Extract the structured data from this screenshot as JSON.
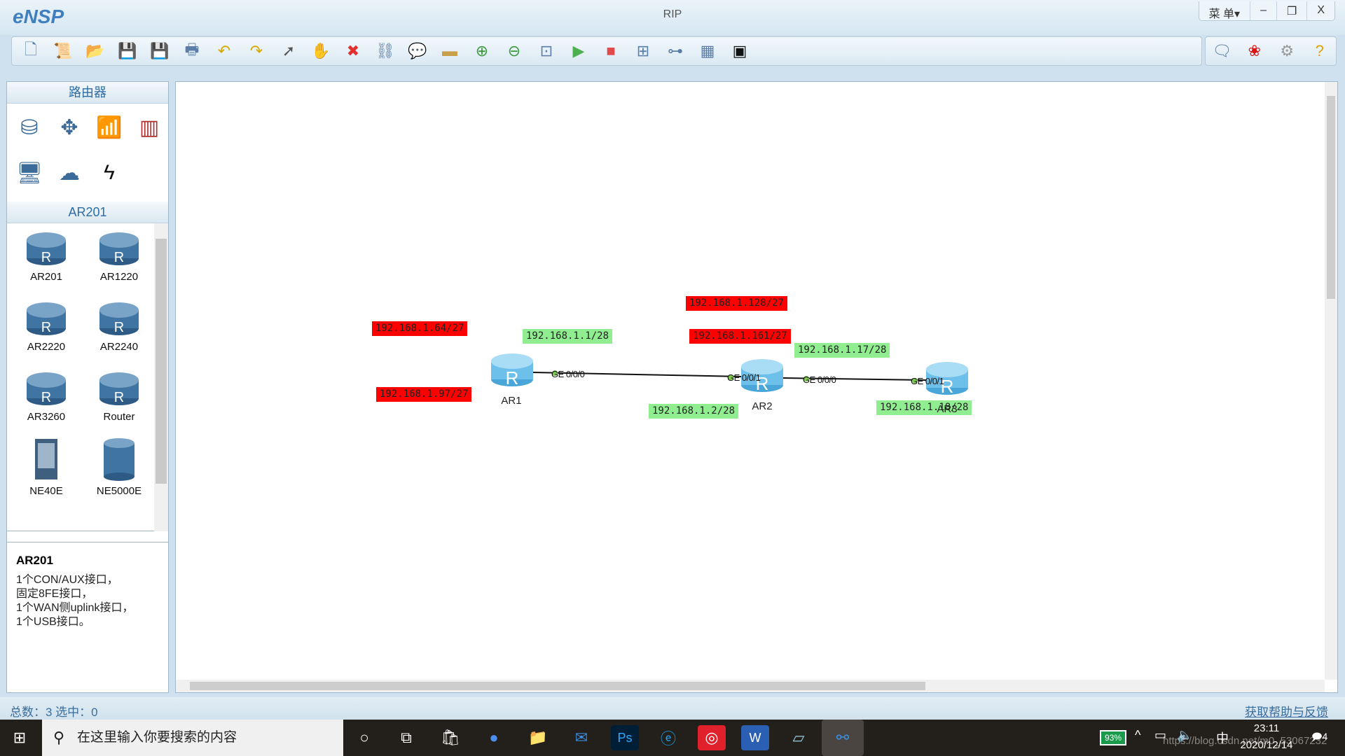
{
  "app": {
    "logo": "eNSP",
    "title": "RIP",
    "menu": "菜 单▾",
    "minimize": "–",
    "restore": "❐",
    "close": "X"
  },
  "toolbar": {
    "icons": [
      "new-topology-icon",
      "new-example-icon",
      "open-icon",
      "save-icon",
      "save-as-icon",
      "print-icon",
      "undo-icon",
      "redo-icon",
      "select-icon",
      "pan-hand-icon",
      "delete-icon",
      "delete-link-icon",
      "text-annotation-icon",
      "rectangle-icon",
      "zoom-in-icon",
      "zoom-out-icon",
      "fit-icon",
      "start-icon",
      "stop-icon",
      "capture-icon",
      "topology-icon",
      "grid-icon",
      "cli-icon"
    ],
    "right_icons": [
      "chat-icon",
      "huawei-icon",
      "settings-icon",
      "help-icon"
    ]
  },
  "sidebar": {
    "category_title": "路由器",
    "categories": [
      "router-icon",
      "switch-icon",
      "wireless-icon",
      "firewall-icon",
      "pc-icon",
      "cloud-icon",
      "link-icon"
    ],
    "device_title": "AR201",
    "devices": [
      {
        "label": "AR201"
      },
      {
        "label": "AR1220"
      },
      {
        "label": "AR2220"
      },
      {
        "label": "AR2240"
      },
      {
        "label": "AR3260"
      },
      {
        "label": "Router"
      },
      {
        "label": "NE40E"
      },
      {
        "label": "NE5000E"
      }
    ],
    "info": {
      "title": "AR201",
      "lines": [
        "1个CON/AUX接口，",
        "固定8FE接口，",
        "1个WAN侧uplink接口，",
        "1个USB接口。"
      ]
    }
  },
  "topology": {
    "nodes": [
      {
        "name": "AR1"
      },
      {
        "name": "AR2"
      },
      {
        "name": "AR3"
      }
    ],
    "interfaces": [
      "GE 0/0/0",
      "GE 0/0/1",
      "GE 0/0/0",
      "GE 0/0/1"
    ],
    "labels": [
      {
        "text": "192.168.1.64/27",
        "color": "#ff0000"
      },
      {
        "text": "192.168.1.1/28",
        "color": "#90ee90"
      },
      {
        "text": "192.168.1.97/27",
        "color": "#ff0000"
      },
      {
        "text": "192.168.1.2/28",
        "color": "#90ee90"
      },
      {
        "text": "192.168.1.128/27",
        "color": "#ff0000"
      },
      {
        "text": "192.168.1.161/27",
        "color": "#ff0000"
      },
      {
        "text": "192.168.1.17/28",
        "color": "#90ee90"
      },
      {
        "text": "192.168.1.18/28",
        "color": "#90ee90"
      }
    ]
  },
  "status": {
    "summary": "总数：3  选中：0",
    "help_link": "获取帮助与反馈"
  },
  "taskbar": {
    "search_placeholder": "在这里输入你要搜索的内容",
    "battery": "93%",
    "ime": "中",
    "time": "23:11",
    "date": "2020/12/14",
    "notifications": "4",
    "watermark": "https://blog.csdn.net/m0_53067232"
  }
}
